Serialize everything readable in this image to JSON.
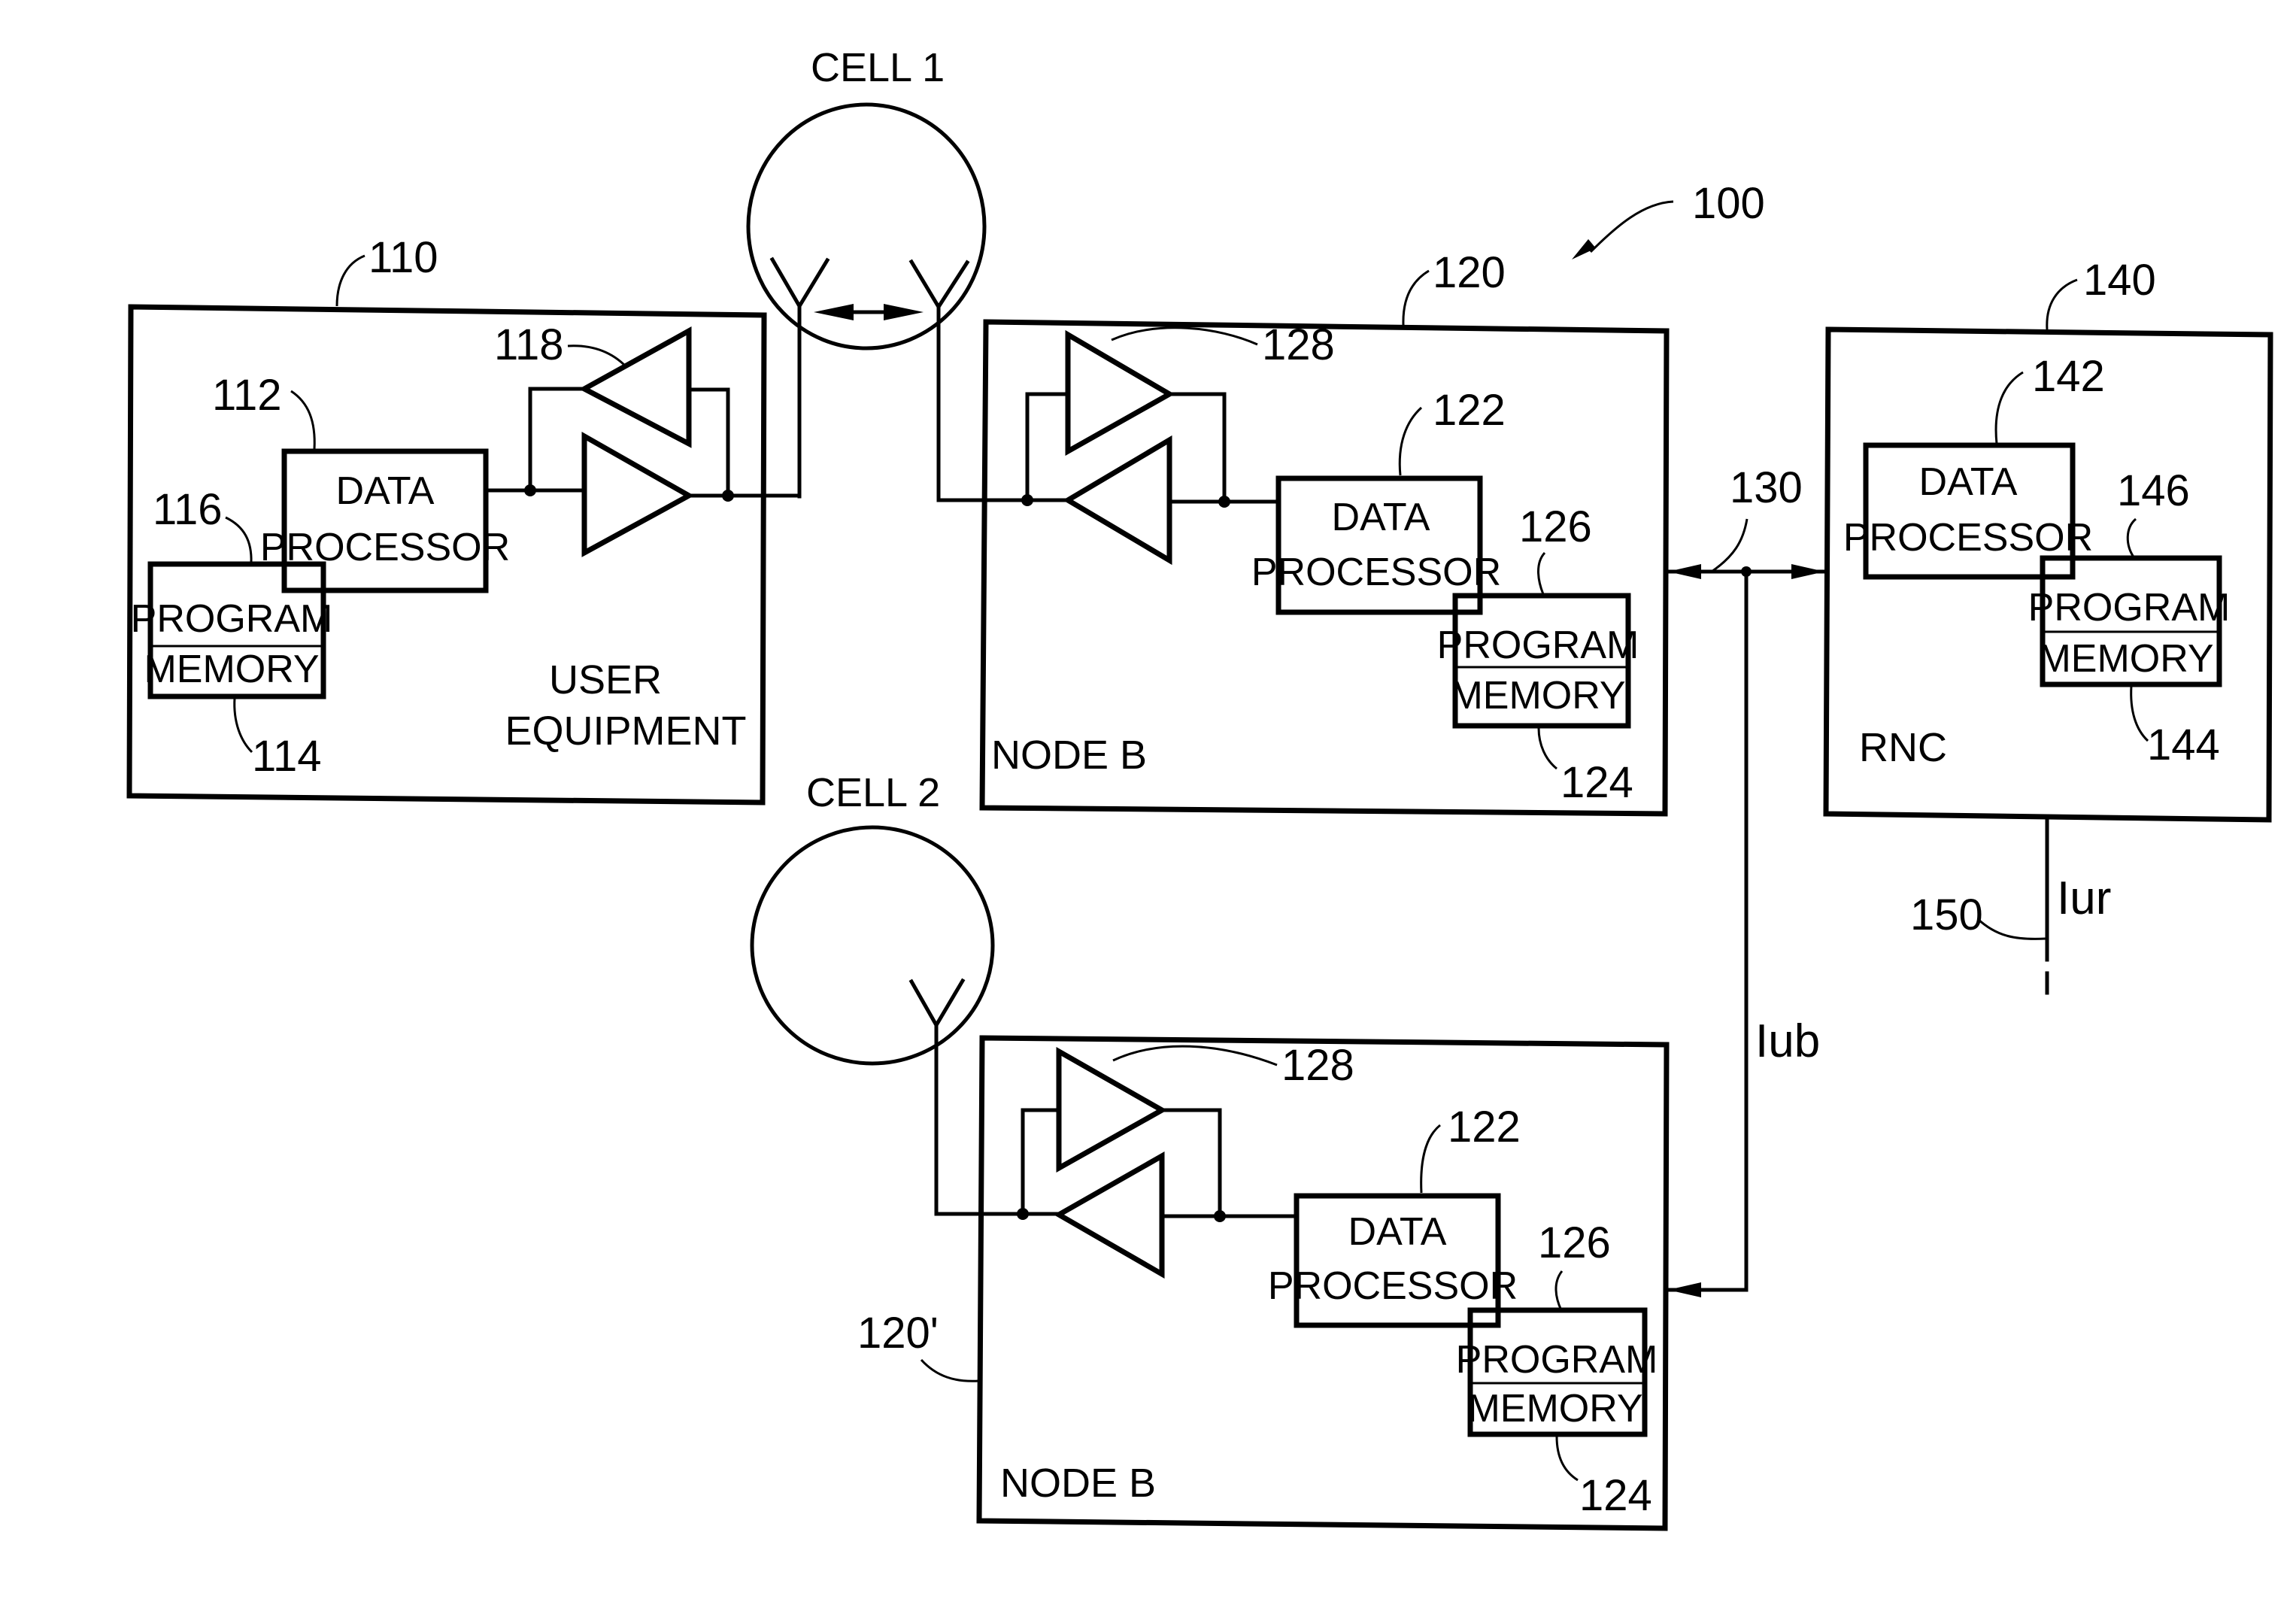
{
  "figure": {
    "system_ref": "100",
    "cells": [
      {
        "label": "CELL 1"
      },
      {
        "label": "CELL 2"
      }
    ],
    "user_equipment": {
      "ref": "110",
      "label_line1": "USER",
      "label_line2": "EQUIPMENT",
      "data_processor": {
        "ref": "112",
        "line1": "DATA",
        "line2": "PROCESSOR"
      },
      "program_memory": {
        "ref": "114",
        "line1": "PROGRAM",
        "line2": "MEMORY"
      },
      "memory_ref": "116",
      "transceiver_ref": "118"
    },
    "node_b_1": {
      "ref": "120",
      "label": "NODE B",
      "data_processor": {
        "ref": "122",
        "line1": "DATA",
        "line2": "PROCESSOR"
      },
      "program_memory": {
        "ref": "124",
        "line1": "PROGRAM",
        "line2": "MEMORY"
      },
      "memory_ref": "126",
      "transceiver_ref": "128"
    },
    "node_b_2": {
      "ref": "120'",
      "label": "NODE B",
      "data_processor": {
        "ref": "122",
        "line1": "DATA",
        "line2": "PROCESSOR"
      },
      "program_memory": {
        "ref": "124",
        "line1": "PROGRAM",
        "line2": "MEMORY"
      },
      "memory_ref": "126",
      "transceiver_ref": "128"
    },
    "rnc": {
      "ref": "140",
      "label": "RNC",
      "data_processor": {
        "ref": "142",
        "line1": "DATA",
        "line2": "PROCESSOR"
      },
      "program_memory": {
        "ref": "144",
        "line1": "PROGRAM",
        "line2": "MEMORY"
      },
      "memory_ref": "146"
    },
    "iub_link": {
      "ref": "130",
      "label": "Iub"
    },
    "iur_link": {
      "ref": "150",
      "label": "Iur"
    }
  }
}
